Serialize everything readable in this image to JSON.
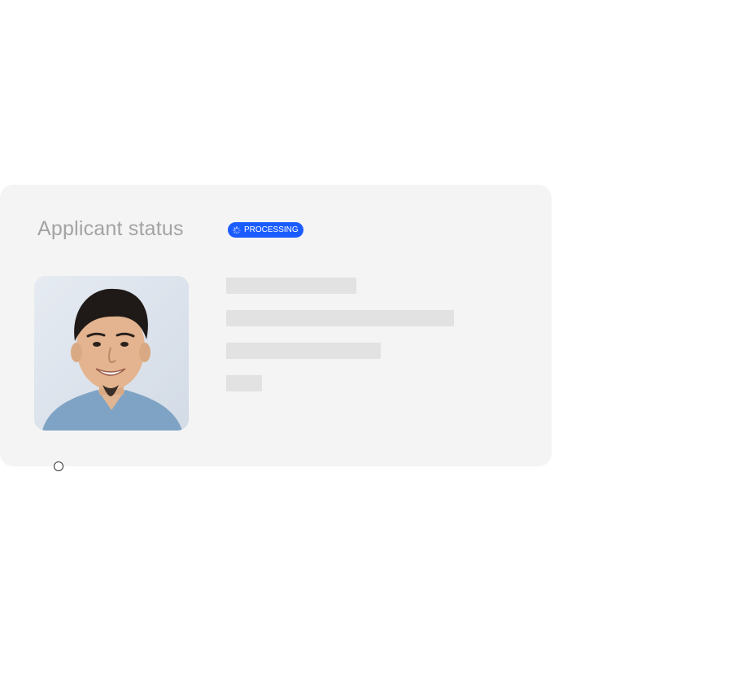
{
  "card": {
    "title": "Applicant status",
    "status_badge": {
      "label": "PROCESSING",
      "icon": "spinner-icon",
      "color": "#1a5cff"
    },
    "photo": {
      "icon": "applicant-photo",
      "background": "#dde3ec"
    },
    "skeleton_color": "#e2e2e2"
  },
  "colors": {
    "card_background": "#f4f4f4",
    "title_text": "#a3a3a3",
    "badge_text": "#ffffff"
  }
}
